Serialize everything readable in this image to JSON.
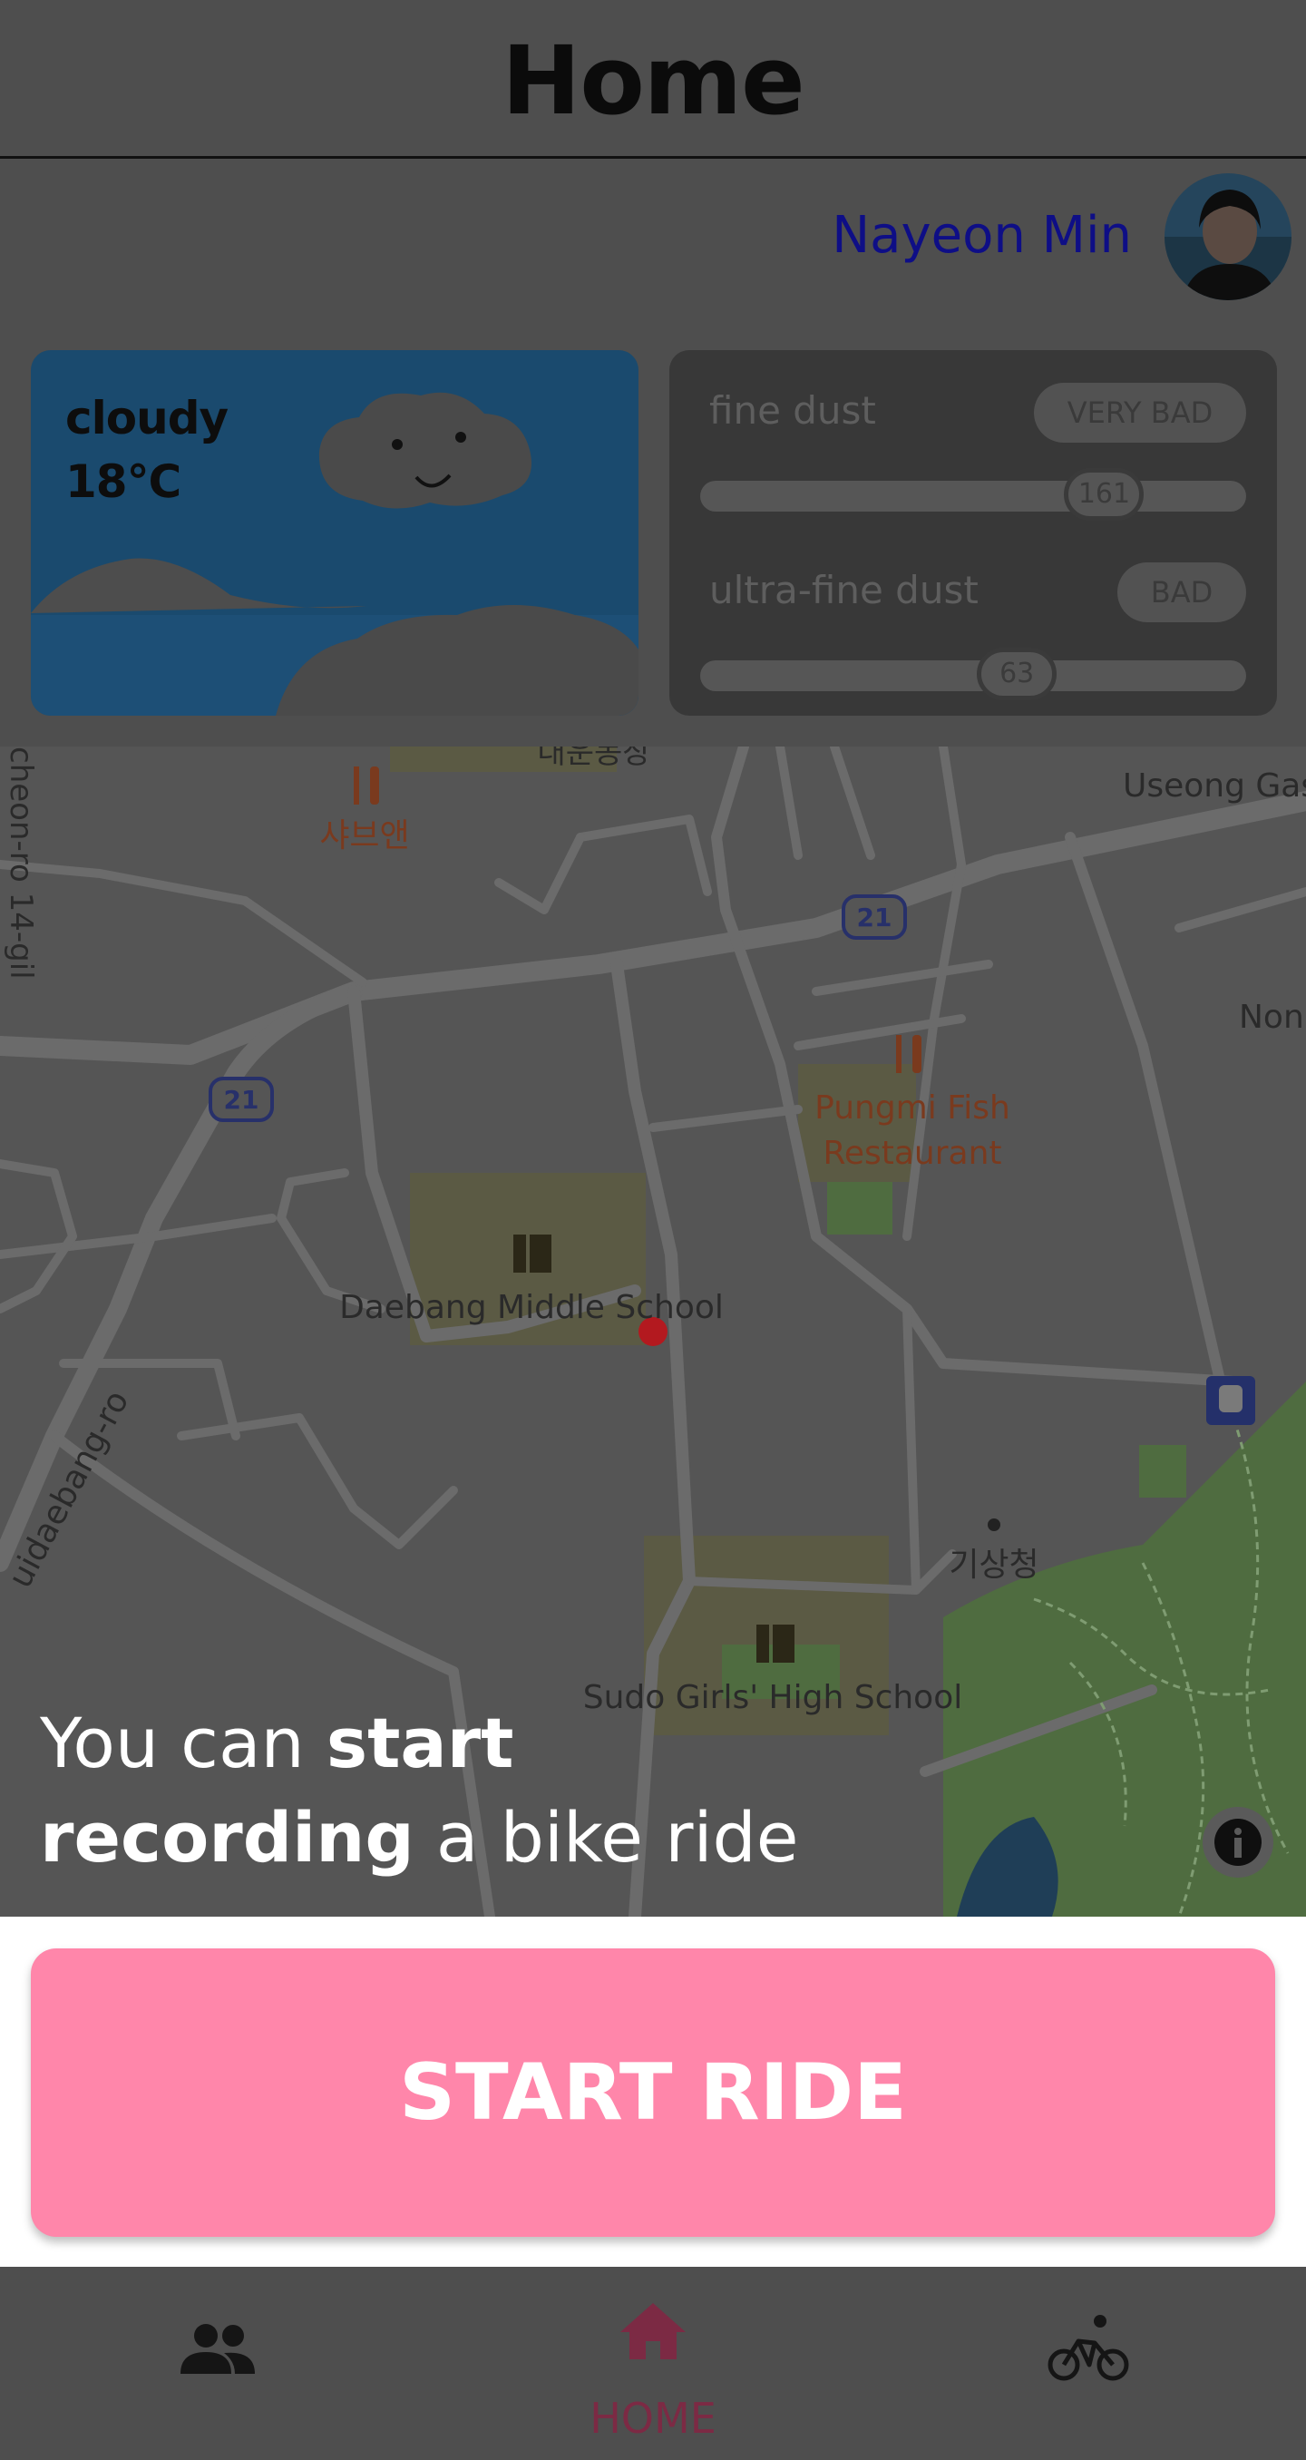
{
  "header": {
    "title": "Home"
  },
  "user": {
    "name": "Nayeon Min"
  },
  "weather": {
    "condition": "cloudy",
    "temperature": "18℃"
  },
  "air_quality": {
    "fine_dust": {
      "label": "fine dust",
      "status": "VERY BAD",
      "value": "161",
      "level_fraction": 0.74
    },
    "ultra_fine_dust": {
      "label": "ultra-fine dust",
      "status": "BAD",
      "value": "63",
      "level_fraction": 0.58
    }
  },
  "map": {
    "labels": {
      "top_center": "대운동장",
      "restaurant_1": "샤브앤",
      "gas": "Useong Gas",
      "road_west": "cheon-ro 14-gil",
      "route_1": "21",
      "route_2": "21",
      "road_east": "Non",
      "fish_line1": "Pungmi Fish",
      "fish_line2": "Restaurant",
      "school_1": "Daebang Middle School",
      "road_sw": "uidaebang-ro",
      "weather_agency": "기상청",
      "school_2": "Sudo Girls' High School"
    },
    "colors": {
      "road": "#6b6b6b",
      "park": "#4f6c40",
      "poi_food": "#7a3a1e",
      "route_badge": "#27306a",
      "marker": "#b3191f"
    }
  },
  "promo": {
    "prefix": "You can ",
    "bold1": "start",
    "bold2": "recording",
    "suffix": " a bike ride"
  },
  "start_button": {
    "label": "START RIDE"
  },
  "nav": {
    "friends_icon": "people-icon",
    "home_icon": "home-icon",
    "home_label": "HOME",
    "ride_icon": "bicycle-icon"
  },
  "colors": {
    "accent": "#ff86aa",
    "home_active": "#7c2a44",
    "user_name": "#0e0e86"
  }
}
